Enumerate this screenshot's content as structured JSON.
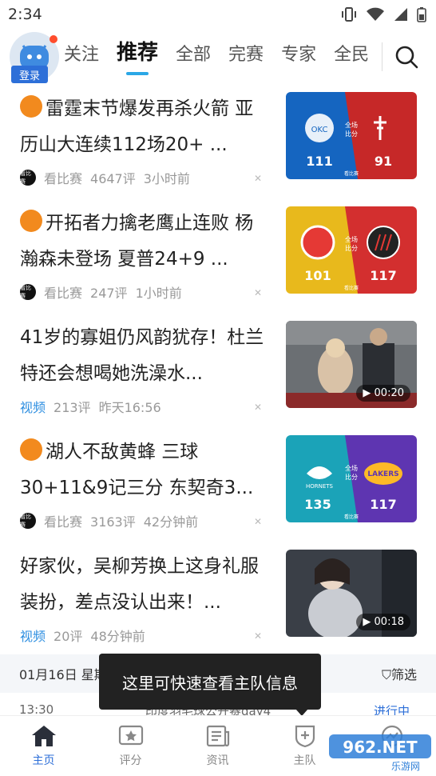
{
  "status_bar": {
    "time": "2:34"
  },
  "header": {
    "login_label": "登录",
    "tabs": [
      {
        "label": "关注"
      },
      {
        "label": "推荐",
        "active": true
      },
      {
        "label": "全部"
      },
      {
        "label": "完赛"
      },
      {
        "label": "专家"
      },
      {
        "label": "全民"
      }
    ]
  },
  "feed": [
    {
      "title": "雷霆末节爆发再杀火箭 亚历山大连续112场20+ ...",
      "has_basketball_icon": true,
      "source": "看比赛",
      "comments": "4647评",
      "time": "3小时前",
      "thumb": {
        "kind": "score",
        "left_score": "111",
        "right_score": "91",
        "left_color": "#1565c0",
        "right_color": "#c62828",
        "center_label": "全场\n比分",
        "brand": "看比赛"
      }
    },
    {
      "title": "开拓者力擒老鹰止连败 杨瀚森未登场 夏普24+9 ...",
      "has_basketball_icon": true,
      "source": "看比赛",
      "comments": "247评",
      "time": "1小时前",
      "thumb": {
        "kind": "score",
        "left_score": "101",
        "right_score": "117",
        "left_color": "#e8b91c",
        "right_color": "#d32f2f",
        "center_label": "全场\n比分",
        "brand": "看比赛"
      }
    },
    {
      "title": "41岁的寡姐仍风韵犹存！杜兰特还会想喝她洗澡水...",
      "has_basketball_icon": false,
      "source": "视频",
      "comments": "213评",
      "time": "昨天16:56",
      "thumb": {
        "kind": "video",
        "duration": "00:20"
      }
    },
    {
      "title": "湖人不敌黄蜂 三球30+11&9记三分 东契奇3...",
      "has_basketball_icon": true,
      "source": "看比赛",
      "comments": "3163评",
      "time": "42分钟前",
      "thumb": {
        "kind": "score",
        "left_score": "135",
        "right_score": "117",
        "left_color": "#1ba3b8",
        "right_color": "#5e35b1",
        "center_label": "全场\n比分",
        "brand": "看比赛"
      }
    },
    {
      "title": "好家伙，吴柳芳换上这身礼服装扮，差点没认出来！...",
      "has_basketball_icon": false,
      "source": "视频",
      "comments": "20评",
      "time": "48分钟前",
      "thumb": {
        "kind": "video",
        "duration": "00:18"
      }
    }
  ],
  "schedule": {
    "date": "01月16日 星期五",
    "filter_label": "筛选",
    "peek_time": "13:30",
    "peek_event": "印度羽毛球公开赛day4",
    "peek_status": "进行中"
  },
  "tooltip": {
    "text": "这里可快速查看主队信息"
  },
  "bottom_nav": [
    {
      "label": "主页",
      "icon": "home-icon",
      "active": true
    },
    {
      "label": "评分",
      "icon": "rating-icon"
    },
    {
      "label": "资讯",
      "icon": "news-icon"
    },
    {
      "label": "主队",
      "icon": "team-icon"
    },
    {
      "label": "",
      "icon": "more-icon"
    }
  ],
  "watermark": {
    "text": "962.NET",
    "sub": "乐游网"
  },
  "colors": {
    "accent": "#2d6fd8",
    "tab_indicator": "#2ba7e6",
    "video_tag": "#2d8ee0"
  }
}
